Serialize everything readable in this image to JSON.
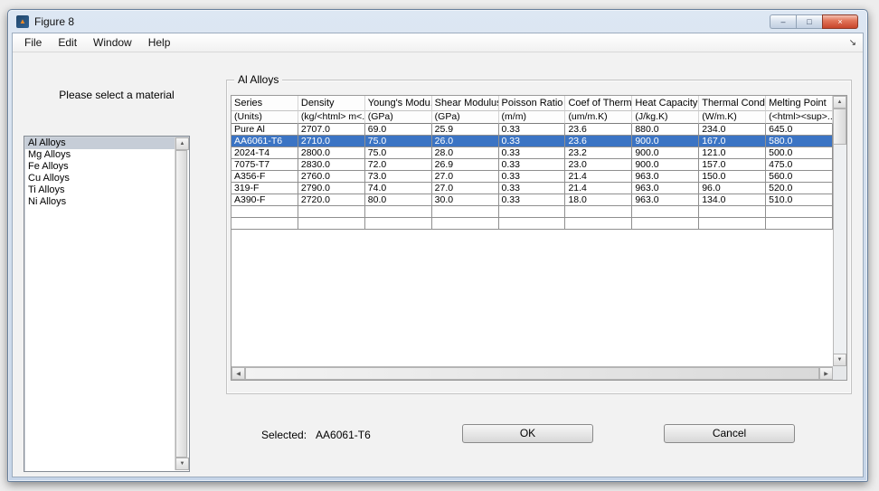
{
  "window": {
    "title": "Figure 8"
  },
  "menu": {
    "items": [
      "File",
      "Edit",
      "Window",
      "Help"
    ]
  },
  "icons": {
    "matlab": "▲",
    "minimize": "–",
    "maximize": "□",
    "close": "×",
    "dock": "↘",
    "up": "▲",
    "down": "▼",
    "left": "◀",
    "right": "▶"
  },
  "material_selector": {
    "prompt": "Please select a material",
    "options": [
      "Al Alloys",
      "Mg Alloys",
      "Fe Alloys",
      "Cu Alloys",
      "Ti Alloys",
      "Ni Alloys"
    ],
    "selected_index": 0
  },
  "table": {
    "group_title": "Al Alloys",
    "columns": [
      "Series",
      "Density",
      "Young's Modu...",
      "Shear Modulus",
      "Poisson Ratio",
      "Coef of Therm...",
      "Heat Capacity",
      "Thermal Cond...",
      "Melting Point"
    ],
    "units": [
      "(Units)",
      "(kg/<html> m<...",
      "(GPa)",
      "(GPa)",
      "(m/m)",
      "(um/m.K)",
      "(J/kg.K)",
      "(W/m.K)",
      "(<html><sup>..."
    ],
    "rows": [
      [
        "Pure Al",
        "2707.0",
        "69.0",
        "25.9",
        "0.33",
        "23.6",
        "880.0",
        "234.0",
        "645.0"
      ],
      [
        "AA6061-T6",
        "2710.0",
        "75.0",
        "26.0",
        "0.33",
        "23.6",
        "900.0",
        "167.0",
        "580.0"
      ],
      [
        "2024-T4",
        "2800.0",
        "75.0",
        "28.0",
        "0.33",
        "23.2",
        "900.0",
        "121.0",
        "500.0"
      ],
      [
        "7075-T7",
        "2830.0",
        "72.0",
        "26.9",
        "0.33",
        "23.0",
        "900.0",
        "157.0",
        "475.0"
      ],
      [
        "A356-F",
        "2760.0",
        "73.0",
        "27.0",
        "0.33",
        "21.4",
        "963.0",
        "150.0",
        "560.0"
      ],
      [
        "319-F",
        "2790.0",
        "74.0",
        "27.0",
        "0.33",
        "21.4",
        "963.0",
        "96.0",
        "520.0"
      ],
      [
        "A390-F",
        "2720.0",
        "80.0",
        "30.0",
        "0.33",
        "18.0",
        "963.0",
        "134.0",
        "510.0"
      ]
    ],
    "selected_row_index": 1,
    "empty_row_count": 2
  },
  "footer": {
    "selected_label": "Selected:",
    "selected_value": "AA6061-T6",
    "ok_label": "OK",
    "cancel_label": "Cancel"
  },
  "colors": {
    "selection_blue": "#3b74c4",
    "list_selection": "#c6cdd7",
    "titlebar_top": "#dde7f3",
    "titlebar_bottom": "#c6d5e8"
  }
}
